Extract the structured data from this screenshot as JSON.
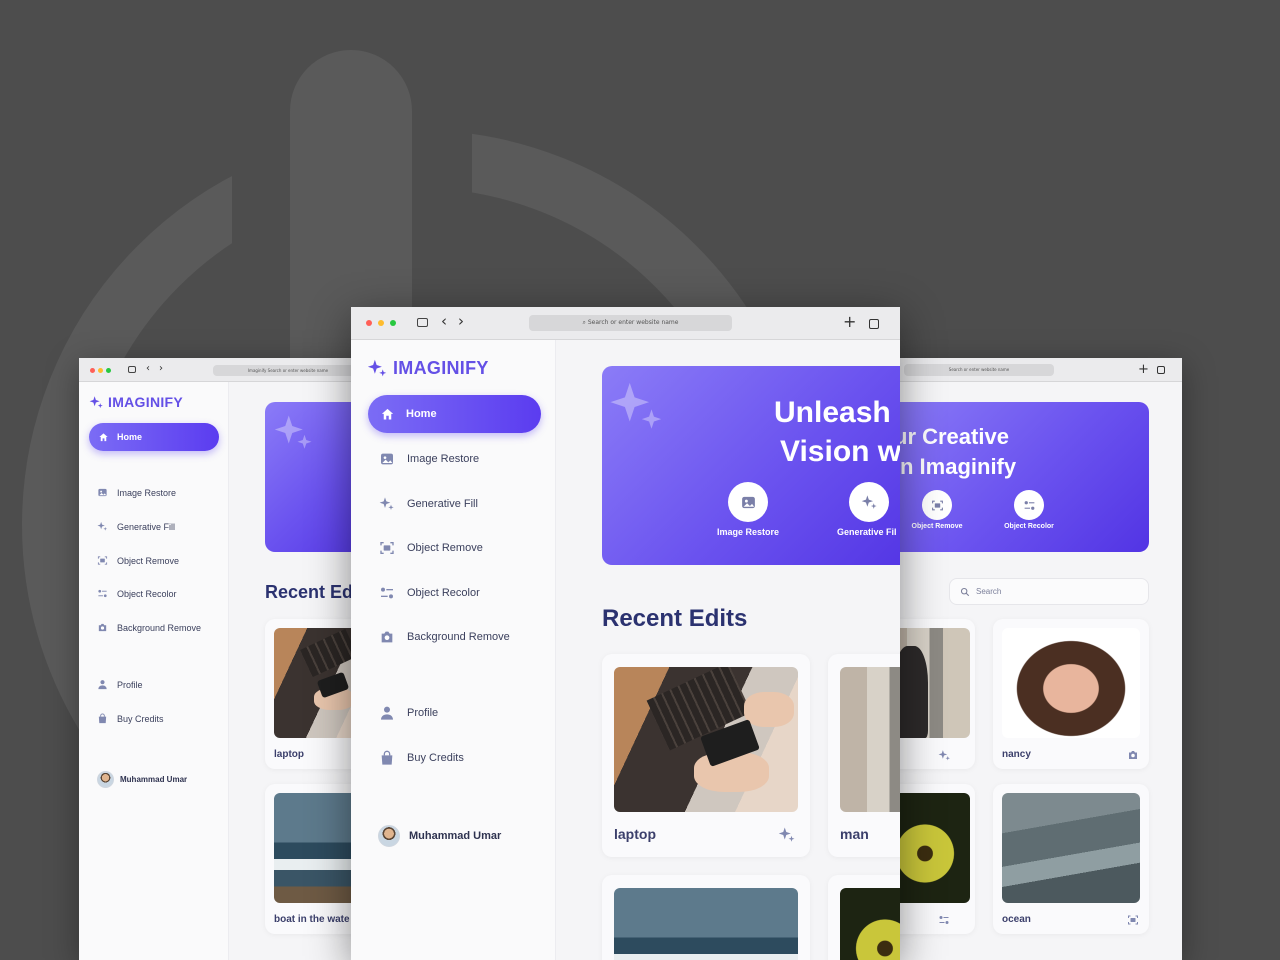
{
  "app": {
    "logo_text": "IMAGINIFY",
    "address_placeholder": "Search or enter website name",
    "left_address": "Imaginify Search or enter website name",
    "nav": [
      {
        "label": "Home",
        "icon": "home-icon",
        "active": true
      },
      {
        "label": "Image Restore",
        "icon": "image-icon"
      },
      {
        "label": "Generative Fill",
        "icon": "sparkles-icon"
      },
      {
        "label": "Object Remove",
        "icon": "scan-icon"
      },
      {
        "label": "Object Recolor",
        "icon": "filter-icon"
      },
      {
        "label": "Background Remove",
        "icon": "camera-icon"
      }
    ],
    "nav_bottom": [
      {
        "label": "Profile",
        "icon": "user-icon"
      },
      {
        "label": "Buy Credits",
        "icon": "bag-icon"
      }
    ],
    "user_name": "Muhammad Umar"
  },
  "center": {
    "banner_line1": "Unleash",
    "banner_line2": "Vision w",
    "actions": [
      "Image Restore",
      "Generative Fil"
    ],
    "section_title": "Recent Edits",
    "cards": [
      "laptop",
      "man"
    ]
  },
  "left": {
    "section_title": "Recent Edi",
    "cards": [
      "laptop",
      "boat in the wate"
    ]
  },
  "right": {
    "banner_line1": "ur Creative",
    "banner_line2": "n Imaginify",
    "actions": [
      "Object Remove",
      "Object Recolor"
    ],
    "search_placeholder": "Search",
    "cards": [
      "nancy",
      "ocean"
    ]
  },
  "colors": {
    "accent": "#6450e6",
    "banner_start": "#8b7cf7",
    "banner_end": "#5234e4",
    "title": "#2b3270",
    "background": "#4d4d4d"
  }
}
